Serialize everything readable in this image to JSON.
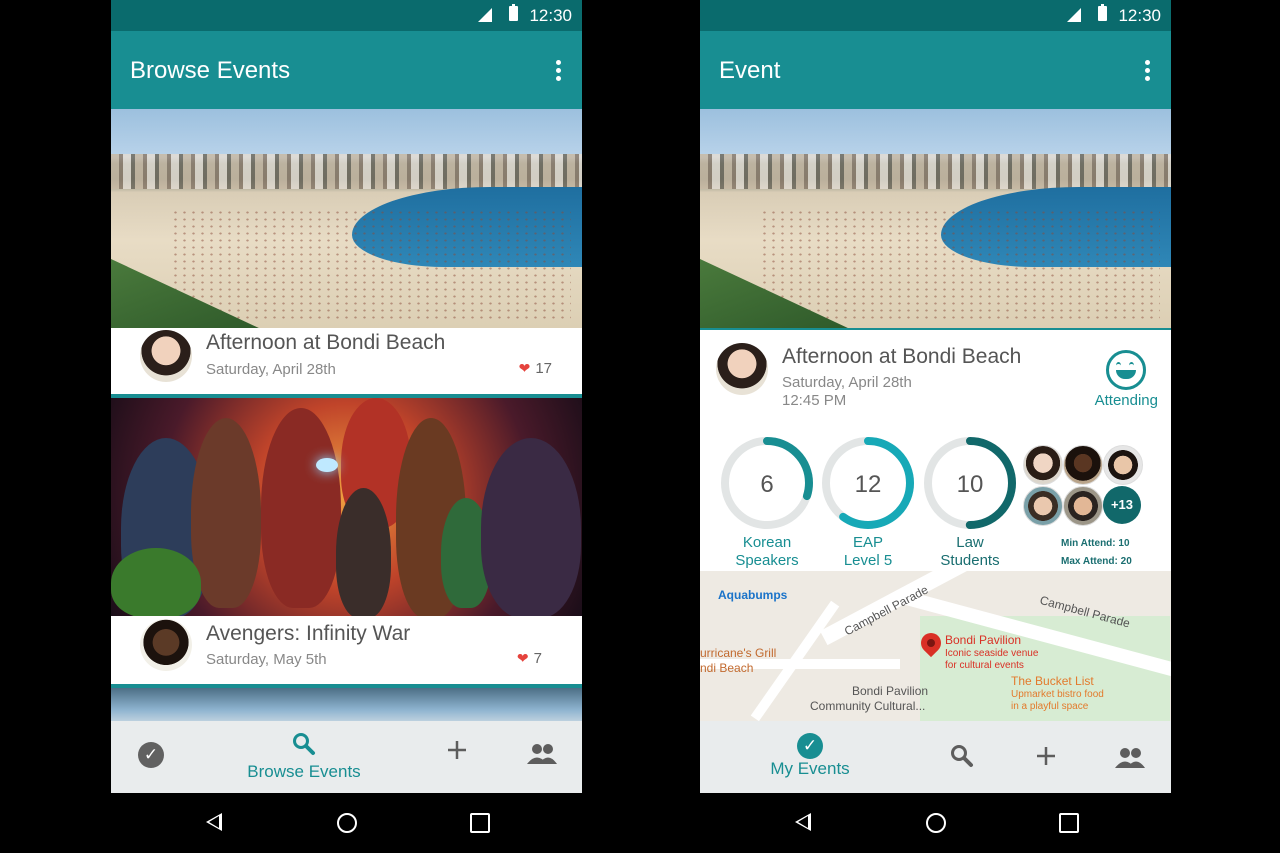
{
  "status_bar": {
    "time": "12:30"
  },
  "browse_screen": {
    "title": "Browse Events",
    "events": [
      {
        "title": "Afternoon at Bondi Beach",
        "date": "Saturday, April 28th",
        "likes": "17"
      },
      {
        "title": "Avengers: Infinity War",
        "date": "Saturday, May 5th",
        "likes": "7"
      }
    ],
    "nav": {
      "active_label": "Browse Events"
    }
  },
  "event_screen": {
    "title": "Event",
    "event": {
      "title": "Afternoon at Bondi Beach",
      "date": "Saturday, April 28th",
      "time": "12:45 PM",
      "attend_label": "Attending"
    },
    "stats": [
      {
        "value": "6",
        "label_line1": "Korean",
        "label_line2": "Speakers",
        "fraction": 0.3,
        "color": "#188e92"
      },
      {
        "value": "12",
        "label_line1": "EAP",
        "label_line2": "Level 5",
        "fraction": 0.6,
        "color": "#17a9b7"
      },
      {
        "value": "10",
        "label_line1": "Law",
        "label_line2": "Students",
        "fraction": 0.5,
        "color": "#11686a"
      }
    ],
    "attendees_more": "+13",
    "min_attend": "Min Attend: 10",
    "max_attend": "Max Attend: 20",
    "map": {
      "labels": {
        "aquabumps": "Aquabumps",
        "campbell_1": "Campbell Parade",
        "campbell_2": "Campbell Parade",
        "hurricanes_1": "urricane's Grill",
        "hurricanes_2": "ndi Beach",
        "pavilion": "Bondi Pavilion",
        "pavilion_desc_1": "Iconic seaside venue",
        "pavilion_desc_2": "for cultural events",
        "bucket": "The Bucket List",
        "bucket_desc_1": "Upmarket bistro food",
        "bucket_desc_2": "in a playful space",
        "community_1": "Bondi Pavilion",
        "community_2": "Community Cultural..."
      }
    },
    "nav": {
      "active_label": "My Events"
    }
  },
  "colors": {
    "primary": "#188e92",
    "status": "#0a6b6d",
    "heart": "#e5433d"
  }
}
